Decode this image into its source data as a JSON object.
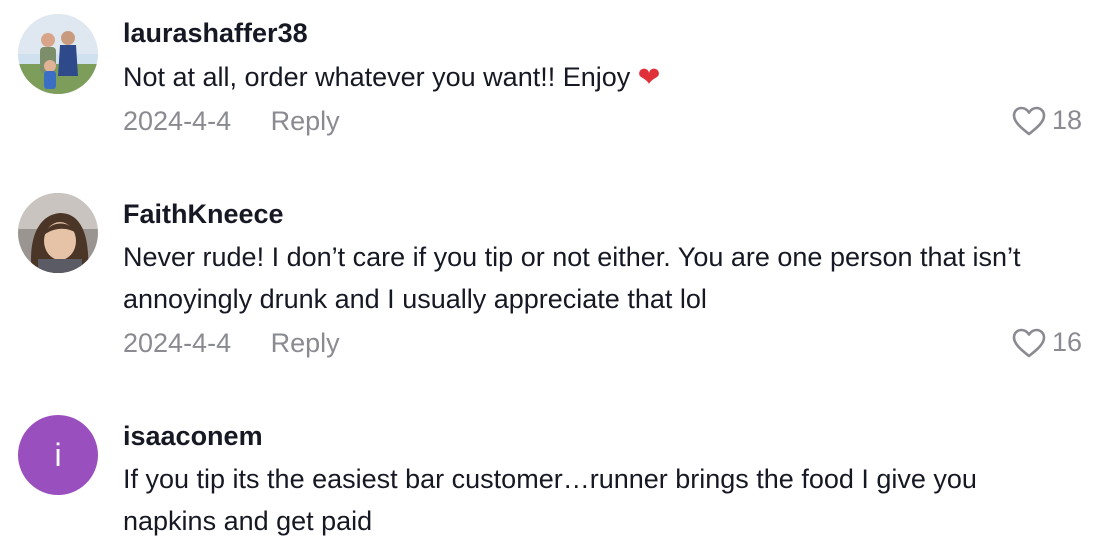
{
  "comments": [
    {
      "username": "laurashaffer38",
      "text": "Not at all, order whatever you want!! Enjoy",
      "emoji": "❤",
      "date": "2024-4-4",
      "reply_label": "Reply",
      "likes": "18"
    },
    {
      "username": "FaithKneece",
      "text": "Never rude! I don’t care if you tip or not either. You are one person that isn’t annoyingly drunk and I usually appreciate that lol",
      "date": "2024-4-4",
      "reply_label": "Reply",
      "likes": "16"
    },
    {
      "username": "isaaconem",
      "avatar_letter": "i",
      "avatar_color": "#9a4fbf",
      "text": "If you tip its the easiest bar customer…runner brings the food I give you napkins and get paid"
    }
  ]
}
